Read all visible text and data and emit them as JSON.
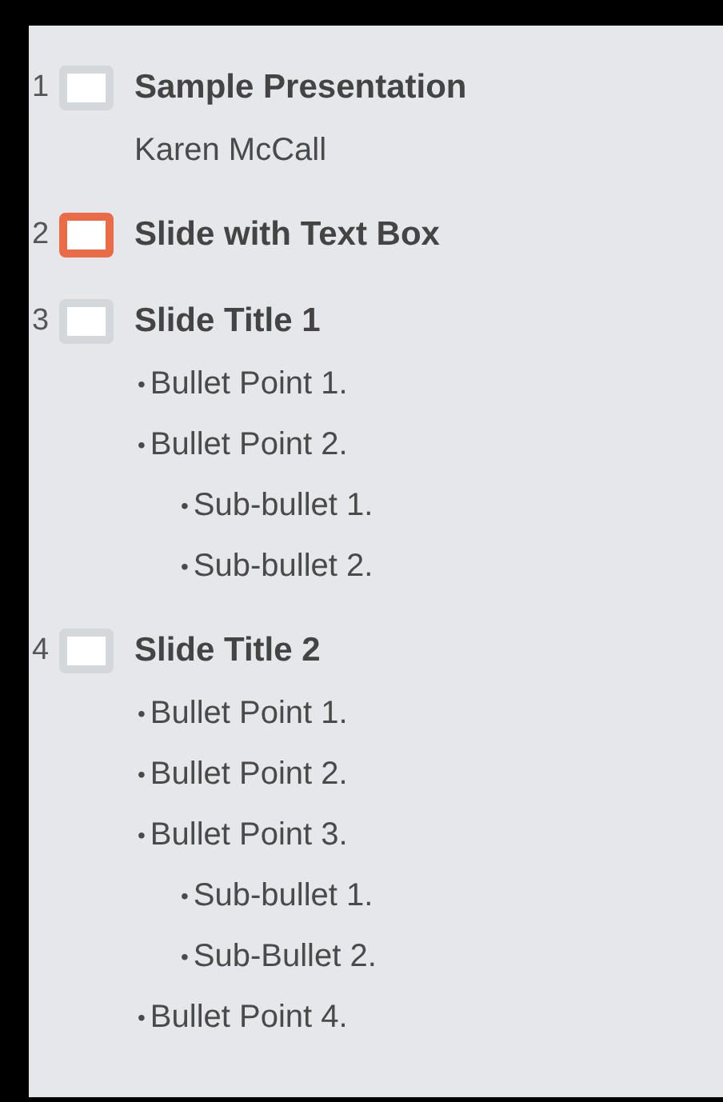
{
  "slides": [
    {
      "number": "1",
      "title": "Sample Presentation",
      "selected": false,
      "children": [
        {
          "text": "Karen McCall"
        }
      ]
    },
    {
      "number": "2",
      "title": "Slide with Text Box",
      "selected": true
    },
    {
      "number": "3",
      "title": "Slide Title 1",
      "selected": false,
      "children": [
        {
          "marker": "•",
          "text": "Bullet Point 1."
        },
        {
          "marker": "•",
          "text": "Bullet Point 2.",
          "children": [
            {
              "marker": "•",
              "text": "Sub-bullet 1."
            },
            {
              "marker": "•",
              "text": "Sub-bullet 2."
            }
          ]
        }
      ]
    },
    {
      "number": "4",
      "title": "Slide Title 2",
      "selected": false,
      "children": [
        {
          "marker": "•",
          "text": "Bullet Point 1."
        },
        {
          "marker": "•",
          "text": "Bullet Point 2."
        },
        {
          "marker": "•",
          "text": "Bullet Point 3.",
          "children": [
            {
              "marker": "•",
              "text": "Sub-bullet 1."
            },
            {
              "marker": "•",
              "text": "Sub-Bullet 2."
            }
          ]
        },
        {
          "marker": "•",
          "text": "Bullet Point 4."
        }
      ]
    }
  ]
}
